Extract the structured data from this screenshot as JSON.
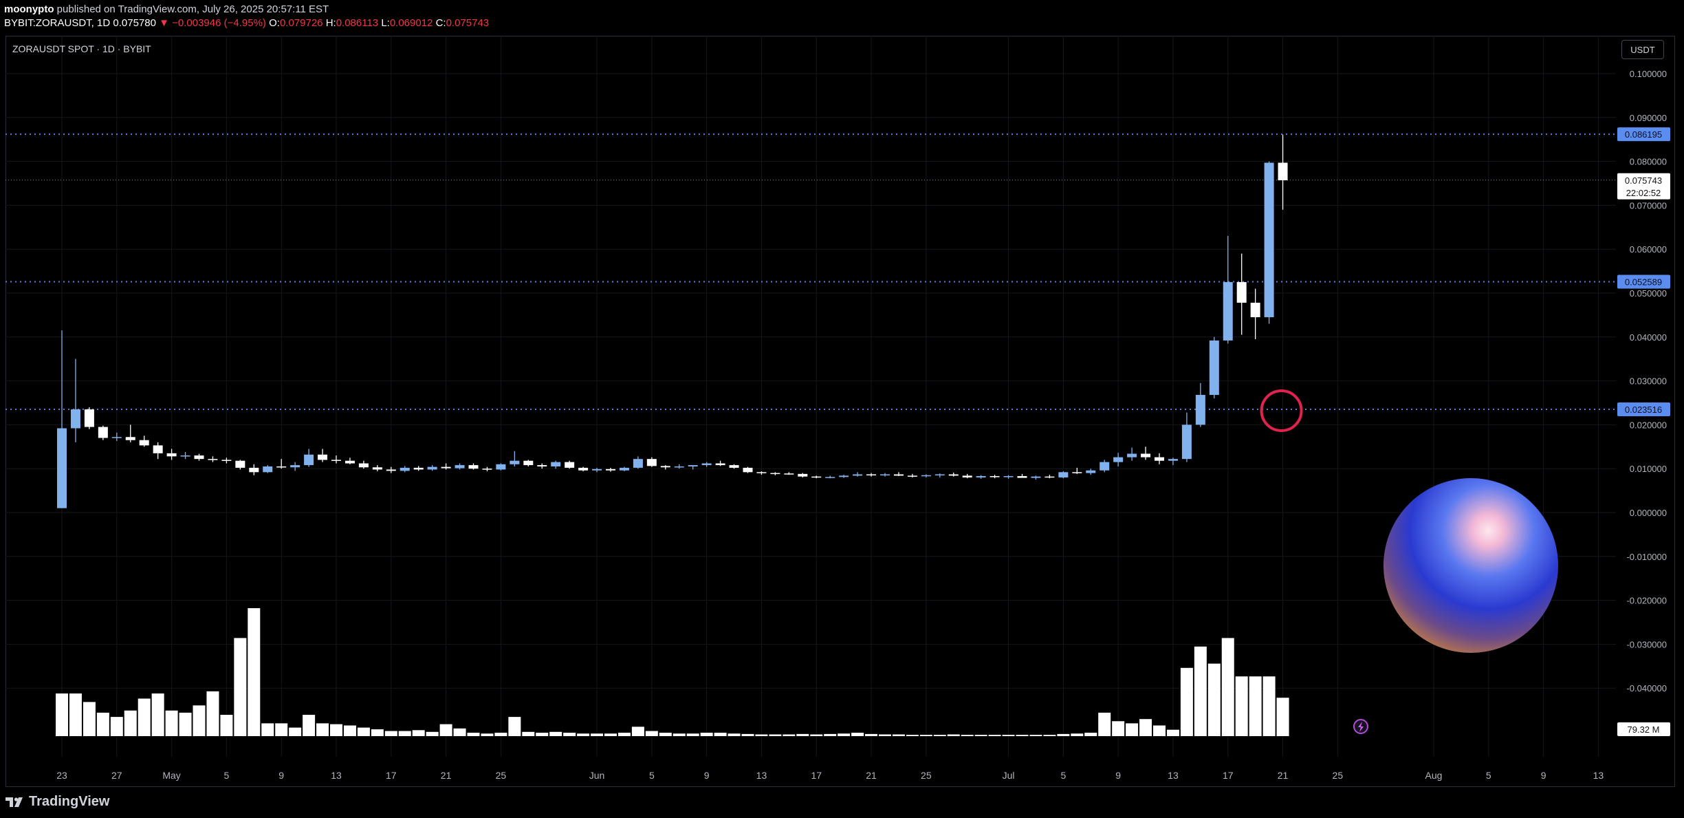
{
  "header": {
    "author": "moonypto",
    "published": "published on TradingView.com, July 26, 2025 20:57:11 EST",
    "ticker": "BYBIT:ZORAUSDT, 1D",
    "last": "0.075780",
    "change": "▼ −0.003946 (−4.95%)",
    "o_label": "O:",
    "o_value": "0.079726",
    "h_label": "H:",
    "h_value": "0.086113",
    "l_label": "L:",
    "l_value": "0.069012",
    "c_label": "C:",
    "c_value": "0.075743"
  },
  "symbol_label": "ZORAUSDT SPOT · 1D · BYBIT",
  "currency_button": "USDT",
  "branding": "TradingView",
  "colors": {
    "up": "#82b2ee",
    "down": "#ffffff",
    "level_line": "#5b7fe0",
    "level_label_bg": "#5b8cf0",
    "circle": "#e0234e",
    "negative_text": "#f23645"
  },
  "chart_data": {
    "type": "candlestick",
    "ylim": [
      -0.05,
      0.105
    ],
    "y_ticks": [
      "0.100000",
      "0.090000",
      "0.080000",
      "0.070000",
      "0.060000",
      "0.050000",
      "0.040000",
      "0.030000",
      "0.020000",
      "0.010000",
      "0.000000",
      "-0.010000",
      "-0.020000",
      "-0.030000",
      "-0.040000"
    ],
    "x_ticks": [
      {
        "label": "23",
        "day": 0
      },
      {
        "label": "27",
        "day": 4
      },
      {
        "label": "May",
        "day": 8
      },
      {
        "label": "5",
        "day": 12
      },
      {
        "label": "9",
        "day": 16
      },
      {
        "label": "13",
        "day": 20
      },
      {
        "label": "17",
        "day": 24
      },
      {
        "label": "21",
        "day": 28
      },
      {
        "label": "25",
        "day": 32
      },
      {
        "label": "Jun",
        "day": 39
      },
      {
        "label": "5",
        "day": 43
      },
      {
        "label": "9",
        "day": 47
      },
      {
        "label": "13",
        "day": 51
      },
      {
        "label": "17",
        "day": 55
      },
      {
        "label": "21",
        "day": 59
      },
      {
        "label": "25",
        "day": 63
      },
      {
        "label": "Jul",
        "day": 69
      },
      {
        "label": "5",
        "day": 73
      },
      {
        "label": "9",
        "day": 77
      },
      {
        "label": "13",
        "day": 81
      },
      {
        "label": "17",
        "day": 85
      },
      {
        "label": "21",
        "day": 89
      },
      {
        "label": "25",
        "day": 93
      },
      {
        "label": "Aug",
        "day": 100
      },
      {
        "label": "5",
        "day": 104
      },
      {
        "label": "9",
        "day": 108
      },
      {
        "label": "13",
        "day": 112
      }
    ],
    "candles": [
      [
        0.001,
        0.0415,
        0.001,
        0.0192,
        1.0
      ],
      [
        0.0192,
        0.035,
        0.016,
        0.0235,
        1.0
      ],
      [
        0.0235,
        0.024,
        0.019,
        0.0195,
        0.8
      ],
      [
        0.0195,
        0.0198,
        0.0165,
        0.017,
        0.55
      ],
      [
        0.017,
        0.0182,
        0.0163,
        0.0172,
        0.45
      ],
      [
        0.0172,
        0.02,
        0.016,
        0.0165,
        0.6
      ],
      [
        0.0165,
        0.0175,
        0.015,
        0.0153,
        0.88
      ],
      [
        0.0153,
        0.016,
        0.0122,
        0.0135,
        1.0
      ],
      [
        0.0135,
        0.0145,
        0.012,
        0.0128,
        0.6
      ],
      [
        0.0128,
        0.0138,
        0.0122,
        0.013,
        0.55
      ],
      [
        0.013,
        0.0134,
        0.0118,
        0.0122,
        0.72
      ],
      [
        0.0122,
        0.0128,
        0.0115,
        0.012,
        1.05
      ],
      [
        0.012,
        0.0125,
        0.0112,
        0.0118,
        0.5
      ],
      [
        0.0118,
        0.012,
        0.0098,
        0.0102,
        2.3
      ],
      [
        0.0102,
        0.011,
        0.0085,
        0.0092,
        3.0
      ],
      [
        0.0092,
        0.0108,
        0.009,
        0.0105,
        0.3
      ],
      [
        0.0105,
        0.0122,
        0.01,
        0.0103,
        0.3
      ],
      [
        0.0103,
        0.0115,
        0.0095,
        0.0108,
        0.2
      ],
      [
        0.0108,
        0.0145,
        0.0104,
        0.0132,
        0.5
      ],
      [
        0.0132,
        0.0145,
        0.0115,
        0.012,
        0.3
      ],
      [
        0.012,
        0.013,
        0.0112,
        0.0118,
        0.28
      ],
      [
        0.0118,
        0.0125,
        0.011,
        0.0112,
        0.25
      ],
      [
        0.0112,
        0.0118,
        0.01,
        0.0103,
        0.2
      ],
      [
        0.0103,
        0.0108,
        0.0094,
        0.0098,
        0.16
      ],
      [
        0.0098,
        0.0104,
        0.009,
        0.0095,
        0.12
      ],
      [
        0.0095,
        0.0106,
        0.0092,
        0.0102,
        0.12
      ],
      [
        0.0102,
        0.0106,
        0.0095,
        0.0098,
        0.14
      ],
      [
        0.0098,
        0.0108,
        0.0095,
        0.0104,
        0.1
      ],
      [
        0.0104,
        0.0112,
        0.0098,
        0.0101,
        0.28
      ],
      [
        0.0101,
        0.0112,
        0.0098,
        0.0108,
        0.18
      ],
      [
        0.0108,
        0.0112,
        0.0098,
        0.01,
        0.08
      ],
      [
        0.01,
        0.0104,
        0.0094,
        0.0098,
        0.06
      ],
      [
        0.0098,
        0.0112,
        0.0096,
        0.011,
        0.08
      ],
      [
        0.011,
        0.014,
        0.0105,
        0.0118,
        0.45
      ],
      [
        0.0118,
        0.012,
        0.0105,
        0.0108,
        0.1
      ],
      [
        0.0108,
        0.0112,
        0.01,
        0.0105,
        0.08
      ],
      [
        0.0105,
        0.0118,
        0.01,
        0.0115,
        0.1
      ],
      [
        0.0115,
        0.0118,
        0.01,
        0.0102,
        0.08
      ],
      [
        0.0102,
        0.0104,
        0.0094,
        0.0096,
        0.06
      ],
      [
        0.0096,
        0.0102,
        0.0092,
        0.0099,
        0.06
      ],
      [
        0.0099,
        0.0102,
        0.0093,
        0.0096,
        0.06
      ],
      [
        0.0096,
        0.0104,
        0.0094,
        0.0102,
        0.08
      ],
      [
        0.0102,
        0.0128,
        0.01,
        0.0122,
        0.22
      ],
      [
        0.0122,
        0.0126,
        0.0104,
        0.0106,
        0.12
      ],
      [
        0.0106,
        0.0108,
        0.0098,
        0.0103,
        0.08
      ],
      [
        0.0103,
        0.011,
        0.01,
        0.0105,
        0.06
      ],
      [
        0.0105,
        0.0108,
        0.0098,
        0.0108,
        0.06
      ],
      [
        0.0108,
        0.0115,
        0.0104,
        0.0112,
        0.08
      ],
      [
        0.0112,
        0.0118,
        0.0106,
        0.0108,
        0.08
      ],
      [
        0.0108,
        0.011,
        0.01,
        0.0102,
        0.06
      ],
      [
        0.0102,
        0.0104,
        0.009,
        0.0092,
        0.05
      ],
      [
        0.0092,
        0.0094,
        0.0086,
        0.009,
        0.04
      ],
      [
        0.009,
        0.0092,
        0.0085,
        0.0089,
        0.04
      ],
      [
        0.0089,
        0.0092,
        0.0086,
        0.0088,
        0.04
      ],
      [
        0.0088,
        0.009,
        0.008,
        0.0082,
        0.05
      ],
      [
        0.0082,
        0.0084,
        0.0078,
        0.008,
        0.04
      ],
      [
        0.008,
        0.0084,
        0.0078,
        0.0081,
        0.05
      ],
      [
        0.0081,
        0.0086,
        0.0079,
        0.0084,
        0.06
      ],
      [
        0.0084,
        0.0092,
        0.0082,
        0.0087,
        0.08
      ],
      [
        0.0087,
        0.009,
        0.0082,
        0.0085,
        0.05
      ],
      [
        0.0085,
        0.009,
        0.0082,
        0.0087,
        0.04
      ],
      [
        0.0087,
        0.0092,
        0.0083,
        0.0084,
        0.04
      ],
      [
        0.0084,
        0.0088,
        0.008,
        0.0083,
        0.03
      ],
      [
        0.0083,
        0.0087,
        0.008,
        0.0085,
        0.03
      ],
      [
        0.0085,
        0.0089,
        0.008,
        0.0087,
        0.03
      ],
      [
        0.0087,
        0.0091,
        0.0082,
        0.0084,
        0.04
      ],
      [
        0.0084,
        0.0088,
        0.0078,
        0.008,
        0.03
      ],
      [
        0.008,
        0.0085,
        0.0077,
        0.0083,
        0.03
      ],
      [
        0.0083,
        0.0086,
        0.0078,
        0.0081,
        0.03
      ],
      [
        0.0081,
        0.0085,
        0.0077,
        0.0083,
        0.03
      ],
      [
        0.0083,
        0.0088,
        0.008,
        0.0079,
        0.03
      ],
      [
        0.0079,
        0.0084,
        0.0075,
        0.0082,
        0.03
      ],
      [
        0.0082,
        0.0086,
        0.0078,
        0.008,
        0.03
      ],
      [
        0.008,
        0.0094,
        0.0078,
        0.0092,
        0.05
      ],
      [
        0.0092,
        0.0102,
        0.0088,
        0.009,
        0.06
      ],
      [
        0.009,
        0.01,
        0.0086,
        0.0096,
        0.08
      ],
      [
        0.0096,
        0.012,
        0.0092,
        0.0115,
        0.55
      ],
      [
        0.0115,
        0.0136,
        0.0105,
        0.0126,
        0.35
      ],
      [
        0.0126,
        0.0148,
        0.0118,
        0.0134,
        0.3
      ],
      [
        0.0134,
        0.015,
        0.012,
        0.0126,
        0.4
      ],
      [
        0.0126,
        0.0135,
        0.011,
        0.0118,
        0.25
      ],
      [
        0.0118,
        0.0125,
        0.0108,
        0.0122,
        0.15
      ],
      [
        0.0122,
        0.0228,
        0.0115,
        0.02,
        1.6
      ],
      [
        0.02,
        0.0295,
        0.0195,
        0.0268,
        2.1
      ],
      [
        0.0268,
        0.04,
        0.026,
        0.0392,
        1.7
      ],
      [
        0.0392,
        0.063,
        0.0385,
        0.0525,
        2.3
      ],
      [
        0.0525,
        0.059,
        0.0405,
        0.0478,
        1.4
      ],
      [
        0.0478,
        0.051,
        0.0395,
        0.0445,
        1.4
      ],
      [
        0.0445,
        0.08,
        0.043,
        0.0797,
        1.4
      ],
      [
        0.0797,
        0.0861,
        0.069,
        0.0757,
        0.9
      ]
    ],
    "levels": [
      "0.086195",
      "0.052589",
      "0.023516"
    ],
    "current_price_label": "0.075743",
    "countdown_label": "22:02:52",
    "volume_label": "79.32 M"
  }
}
